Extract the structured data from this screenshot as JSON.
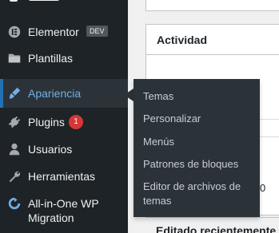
{
  "sidebar": {
    "items": [
      {
        "key": "elementor",
        "label": "Elementor",
        "badge": "DEV",
        "icon": "elementor-icon"
      },
      {
        "key": "plantillas",
        "label": "Plantillas",
        "icon": "folder-icon"
      },
      {
        "key": "apariencia",
        "label": "Apariencia",
        "icon": "paintbrush-icon",
        "current": true
      },
      {
        "key": "plugins",
        "label": "Plugins",
        "count": "1",
        "icon": "plug-icon"
      },
      {
        "key": "usuarios",
        "label": "Usuarios",
        "icon": "user-icon"
      },
      {
        "key": "herramientas",
        "label": "Herramientas",
        "icon": "wrench-icon"
      },
      {
        "key": "aio-migration",
        "label": "All-in-One WP Migration",
        "icon": "migration-icon"
      }
    ]
  },
  "submenu": {
    "parent": "Apariencia",
    "items": [
      "Temas",
      "Personalizar",
      "Menús",
      "Patrones de bloques",
      "Editor de archivos de temas"
    ]
  },
  "main": {
    "activity_title": "Actividad",
    "partial_number": "0",
    "bottom_title": "Editado recientemente"
  },
  "colors": {
    "sidebar_bg": "#1d2327",
    "flyout_bg": "#2c3338",
    "accent": "#72aee6",
    "current_bar": "#2271b1",
    "badge_red": "#d63638"
  }
}
